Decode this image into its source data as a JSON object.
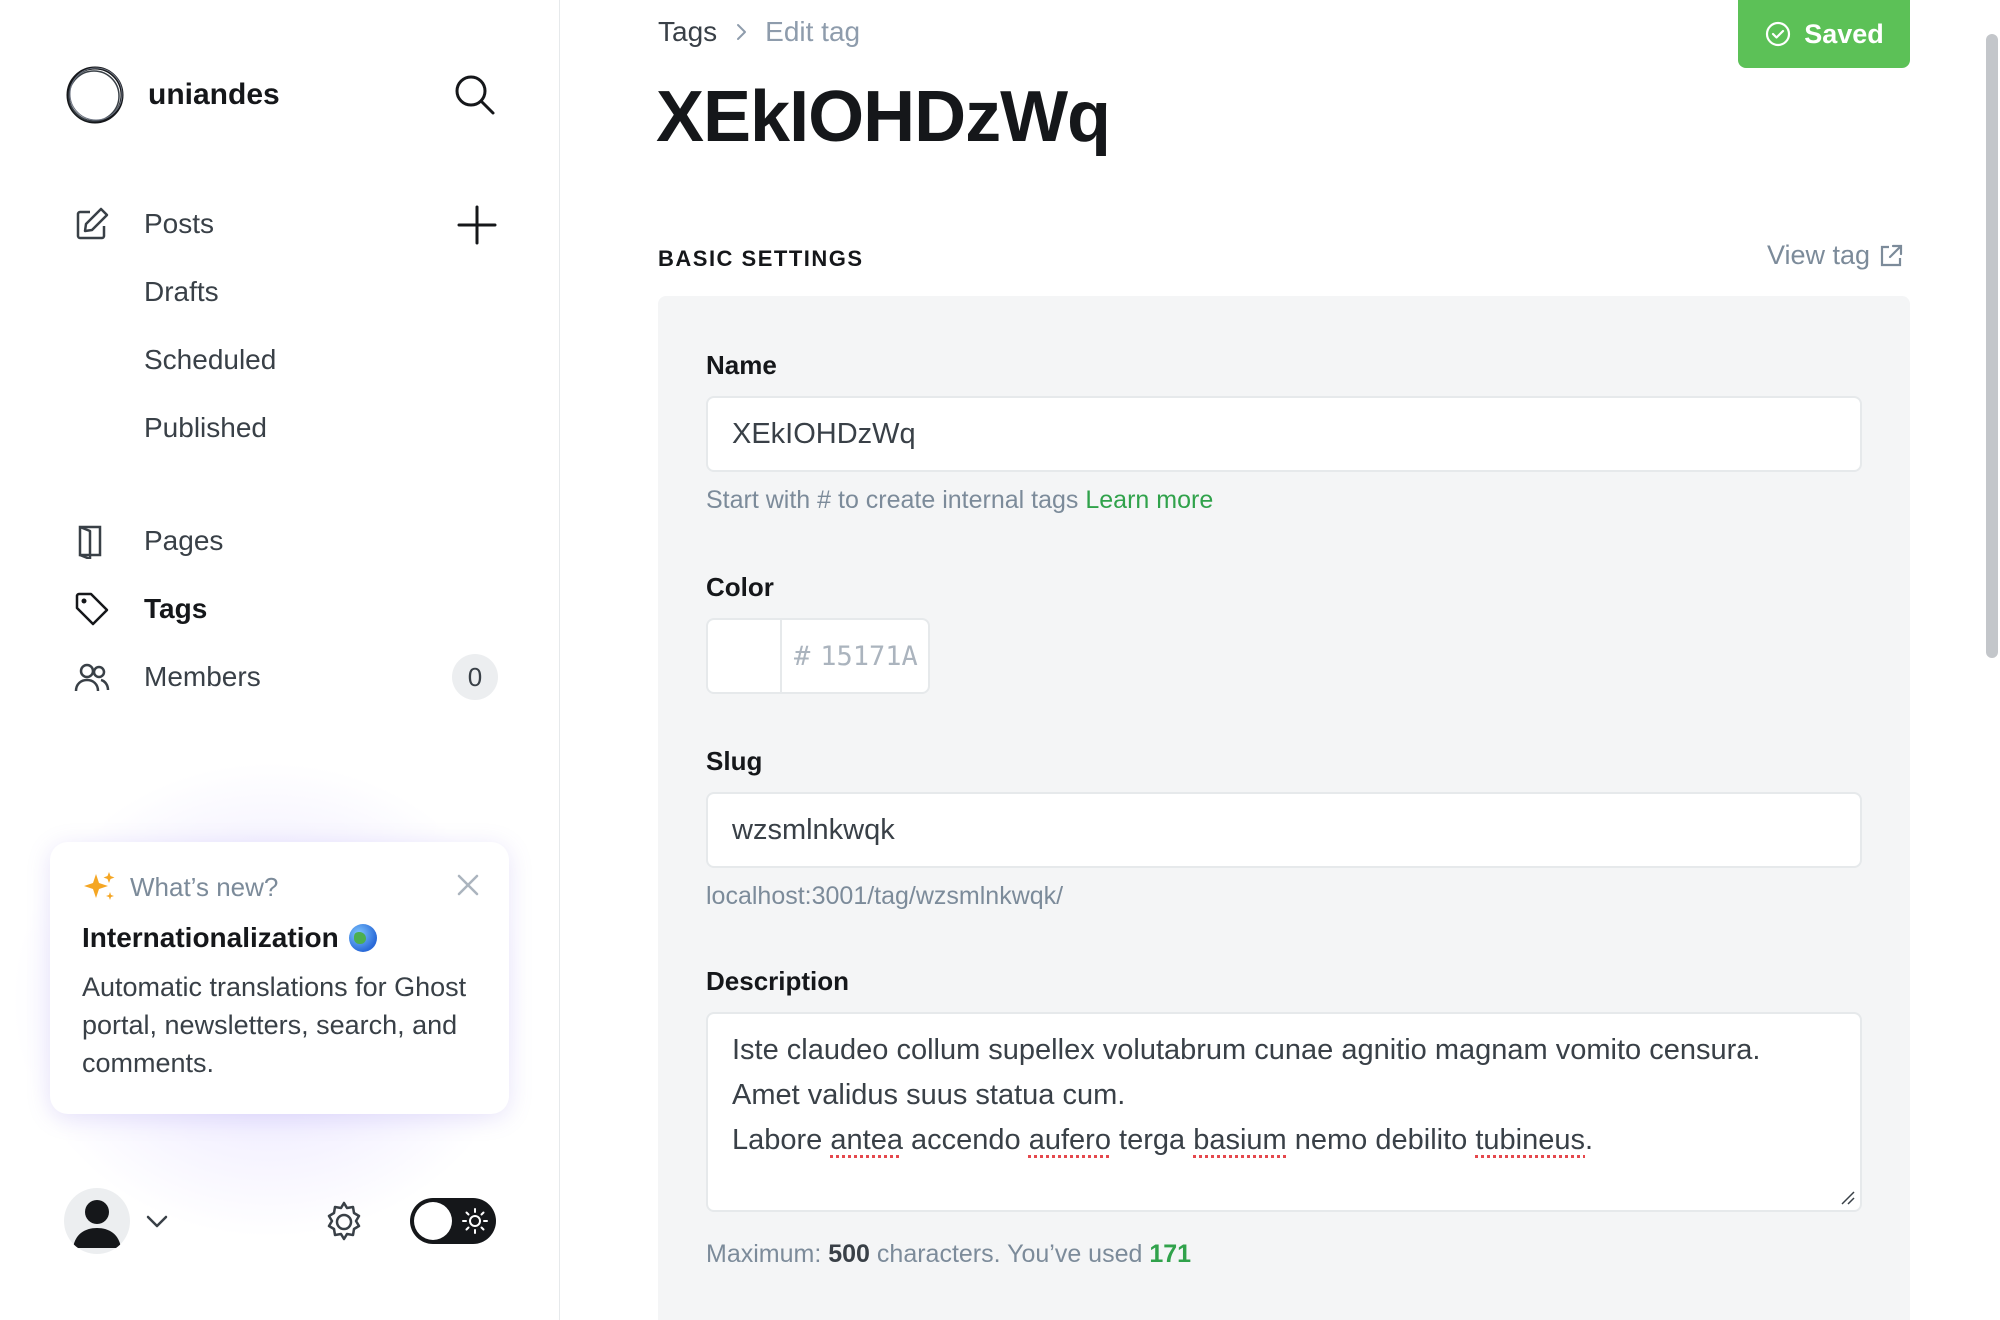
{
  "sidebar": {
    "brand": {
      "name": "uniandes"
    },
    "nav": {
      "posts": "Posts",
      "drafts": "Drafts",
      "scheduled": "Scheduled",
      "published": "Published",
      "pages": "Pages",
      "tags": "Tags",
      "members": "Members",
      "members_count": "0"
    },
    "whats_new": {
      "heading": "What’s new?",
      "title": "Internationalization",
      "body": "Automatic translations for Ghost portal, newsletters, search, and comments."
    },
    "icons": [
      "logo-icon",
      "search-icon",
      "edit-icon",
      "plus-icon",
      "pages-icon",
      "tag-icon",
      "members-icon",
      "sparkle-icon",
      "close-icon",
      "globe-icon",
      "avatar-icon",
      "chevron-down-icon",
      "gear-icon",
      "sun-icon"
    ]
  },
  "main": {
    "breadcrumb": {
      "root": "Tags",
      "current": "Edit tag"
    },
    "title": "XEkIOHDzWq",
    "save_status": "Saved",
    "section": {
      "label": "BASIC SETTINGS",
      "view_link": "View tag"
    },
    "form": {
      "name": {
        "label": "Name",
        "value": "XEkIOHDzWq",
        "hint": "Start with # to create internal tags",
        "hint_link": "Learn more"
      },
      "color": {
        "label": "Color",
        "hash": "#",
        "value": "15171A"
      },
      "slug": {
        "label": "Slug",
        "value": "wzsmlnkwqk",
        "url": "localhost:3001/tag/wzsmlnkwqk/"
      },
      "description": {
        "label": "Description",
        "lines": [
          "Iste claudeo collum supellex volutabrum cunae agnitio magnam vomito censura.",
          "Amet validus suus statua cum.",
          "Labore antea accendo aufero terga basium nemo debilito tubineus."
        ],
        "max_prefix": "Maximum:",
        "max": "500",
        "used_prefix": "characters. You’ve used",
        "used": "171"
      }
    }
  },
  "colors": {
    "accent_green": "#5cc157",
    "link_green": "#30a24b",
    "text_dark": "#15171a",
    "text_muted": "#7c8b9a",
    "panel_bg": "#f4f5f6"
  }
}
